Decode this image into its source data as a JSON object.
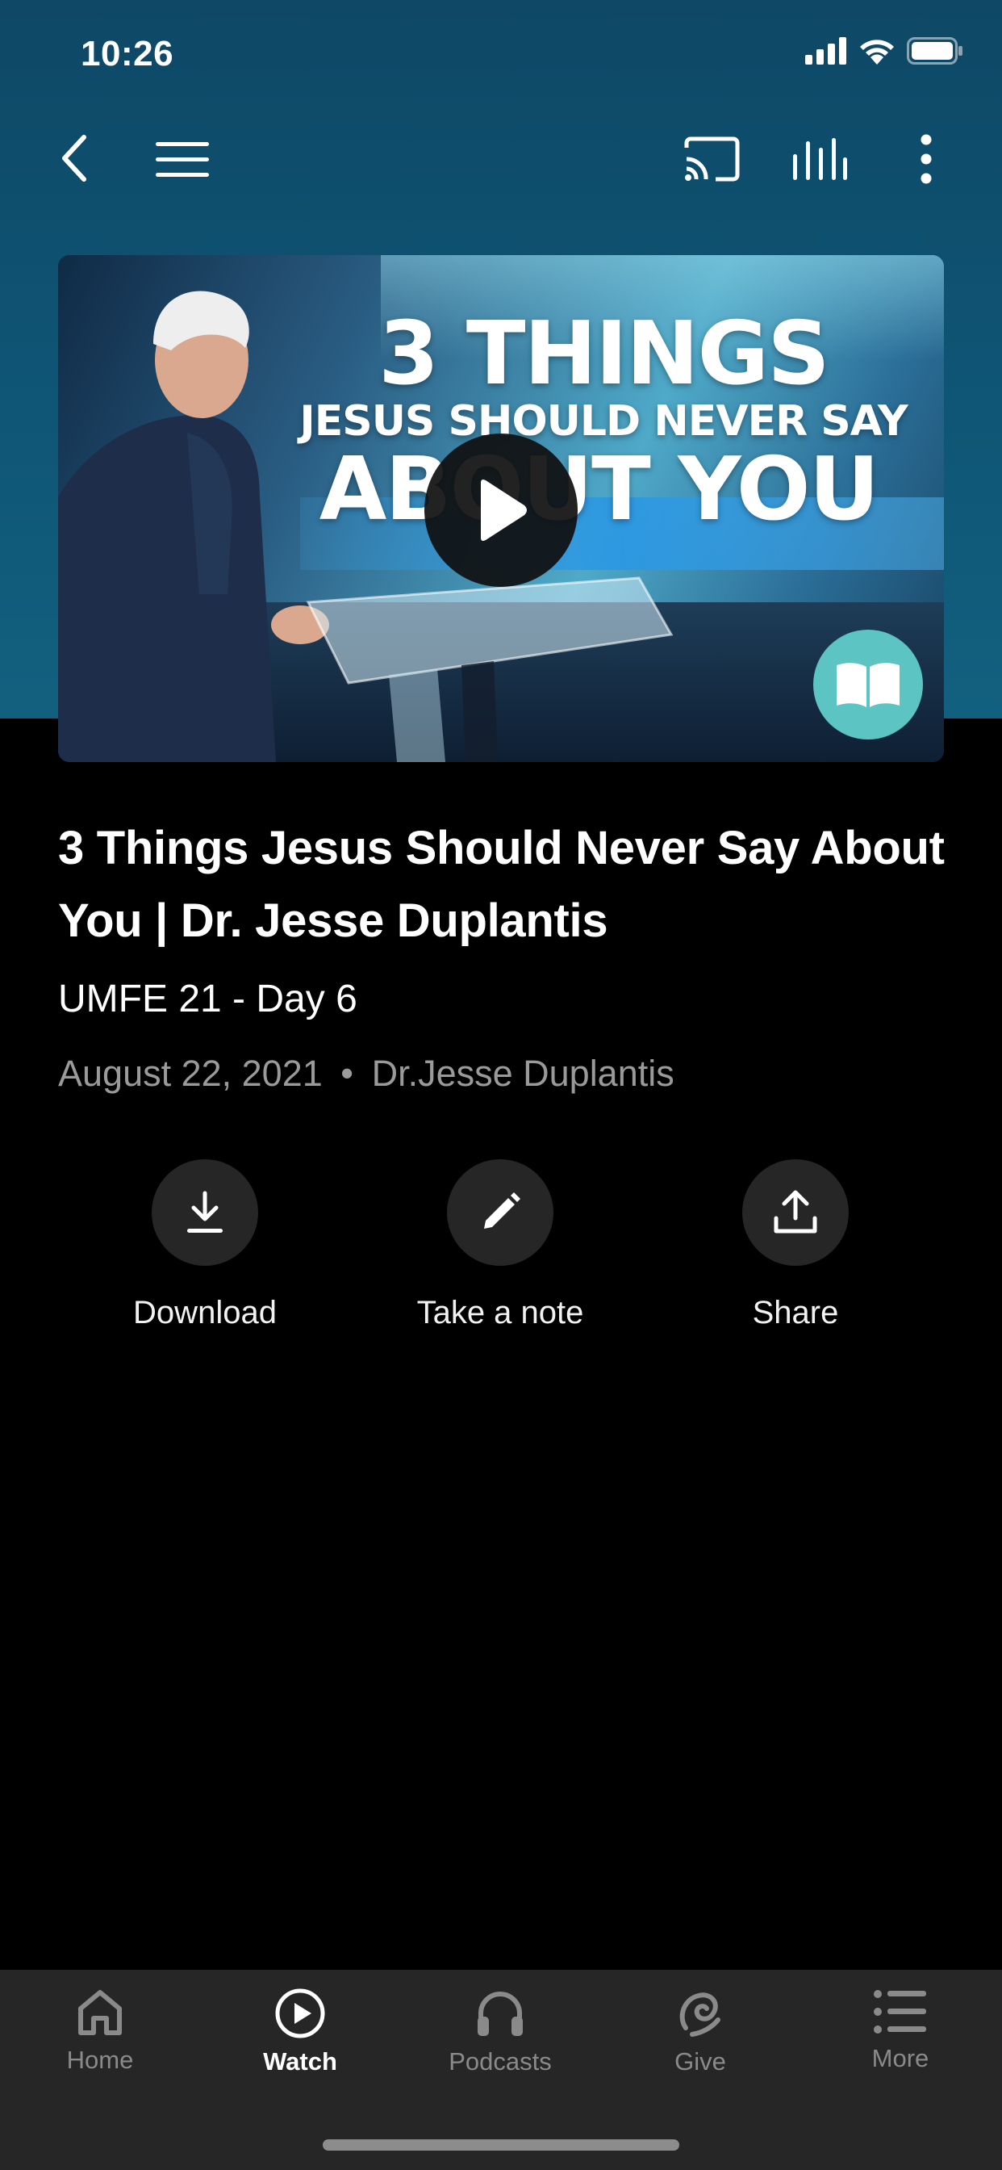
{
  "status_bar": {
    "time": "10:26"
  },
  "nav": {
    "back_icon": "chevron-left-icon",
    "menu_icon": "hamburger-menu-icon",
    "cast_icon": "cast-icon",
    "audio_icon": "audio-levels-icon",
    "more_icon": "more-vertical-icon"
  },
  "video": {
    "thumbnail_lines": [
      "3 THINGS",
      "JESUS SHOULD NEVER SAY",
      "ABOUT YOU"
    ],
    "play_icon": "play-icon",
    "bible_icon": "open-book-icon"
  },
  "episode": {
    "title": "3 Things Jesus Should Never Say About You | Dr. Jesse Duplantis",
    "series": "UMFE 21 - Day 6",
    "date": "August 22, 2021",
    "separator": "•",
    "speaker": "Dr.Jesse Duplantis"
  },
  "actions": [
    {
      "label": "Download",
      "icon": "download-icon"
    },
    {
      "label": "Take a note",
      "icon": "pencil-icon"
    },
    {
      "label": "Share",
      "icon": "share-icon"
    }
  ],
  "tabs": [
    {
      "label": "Home",
      "icon": "home-icon",
      "active": false
    },
    {
      "label": "Watch",
      "icon": "play-circle-icon",
      "active": true
    },
    {
      "label": "Podcasts",
      "icon": "headphones-icon",
      "active": false
    },
    {
      "label": "Give",
      "icon": "give-icon",
      "active": false
    },
    {
      "label": "More",
      "icon": "list-icon",
      "active": false
    }
  ],
  "colors": {
    "header_bg": "#0f5575",
    "accent_teal": "#5cc4c2",
    "tab_bar_bg": "#262626",
    "inactive_tab": "#8a8a8a"
  }
}
